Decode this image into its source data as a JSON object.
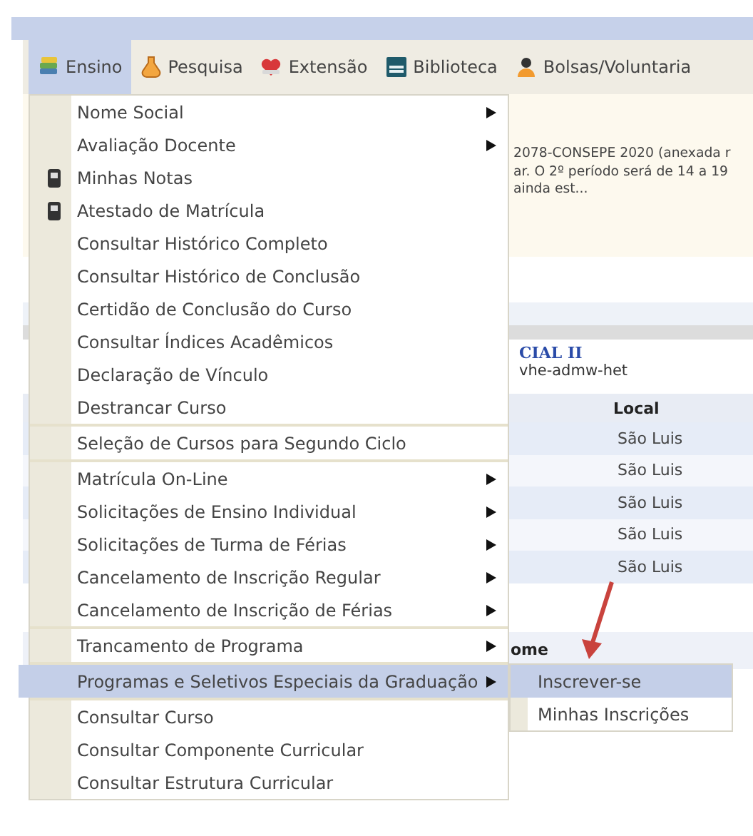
{
  "menubar": [
    {
      "label": "Ensino",
      "selected": true
    },
    {
      "label": "Pesquisa",
      "selected": false
    },
    {
      "label": "Extensão",
      "selected": false
    },
    {
      "label": "Biblioteca",
      "selected": false
    },
    {
      "label": "Bolsas/Voluntaria",
      "selected": false
    }
  ],
  "background": {
    "notice_lines": [
      "2078-CONSEPE 2020 (anexada r",
      "ar. O 2º período será de 14 a 19",
      "ainda est..."
    ],
    "course_title": "CIAL II",
    "course_code": "vhe-admw-het",
    "table": {
      "header": "Local",
      "rows": [
        "São Luis",
        "São Luis",
        "São Luis",
        "São Luis",
        "São Luis"
      ]
    },
    "second_header": "ome"
  },
  "menu": {
    "groups": [
      [
        {
          "label": "Nome Social",
          "submenu": true,
          "icon": false,
          "selected": false
        },
        {
          "label": "Avaliação Docente",
          "submenu": true,
          "icon": false,
          "selected": false
        },
        {
          "label": "Minhas Notas",
          "submenu": false,
          "icon": true,
          "selected": false
        },
        {
          "label": "Atestado de Matrícula",
          "submenu": false,
          "icon": true,
          "selected": false
        },
        {
          "label": "Consultar Histórico Completo",
          "submenu": false,
          "icon": false,
          "selected": false
        },
        {
          "label": "Consultar Histórico de Conclusão",
          "submenu": false,
          "icon": false,
          "selected": false
        },
        {
          "label": "Certidão de Conclusão do Curso",
          "submenu": false,
          "icon": false,
          "selected": false
        },
        {
          "label": "Consultar Índices Acadêmicos",
          "submenu": false,
          "icon": false,
          "selected": false
        },
        {
          "label": "Declaração de Vínculo",
          "submenu": false,
          "icon": false,
          "selected": false
        },
        {
          "label": "Destrancar Curso",
          "submenu": false,
          "icon": false,
          "selected": false
        }
      ],
      [
        {
          "label": "Seleção de Cursos para Segundo Ciclo",
          "submenu": false,
          "icon": false,
          "selected": false
        }
      ],
      [
        {
          "label": "Matrícula On-Line",
          "submenu": true,
          "icon": false,
          "selected": false
        },
        {
          "label": "Solicitações de Ensino Individual",
          "submenu": true,
          "icon": false,
          "selected": false
        },
        {
          "label": "Solicitações de Turma de Férias",
          "submenu": true,
          "icon": false,
          "selected": false
        },
        {
          "label": "Cancelamento de Inscrição Regular",
          "submenu": true,
          "icon": false,
          "selected": false
        },
        {
          "label": "Cancelamento de Inscrição de Férias",
          "submenu": true,
          "icon": false,
          "selected": false
        }
      ],
      [
        {
          "label": "Trancamento de Programa",
          "submenu": true,
          "icon": false,
          "selected": false
        }
      ],
      [
        {
          "label": "Programas e Seletivos Especiais da Graduação",
          "submenu": true,
          "icon": false,
          "selected": true
        }
      ],
      [
        {
          "label": "Consultar Curso",
          "submenu": false,
          "icon": false,
          "selected": false
        },
        {
          "label": "Consultar Componente Curricular",
          "submenu": false,
          "icon": false,
          "selected": false
        },
        {
          "label": "Consultar Estrutura Curricular",
          "submenu": false,
          "icon": false,
          "selected": false
        }
      ]
    ]
  },
  "submenu": {
    "items": [
      {
        "label": "Inscrever-se",
        "selected": true
      },
      {
        "label": "Minhas Inscrições",
        "selected": false
      }
    ]
  },
  "annotation_arrow": true
}
